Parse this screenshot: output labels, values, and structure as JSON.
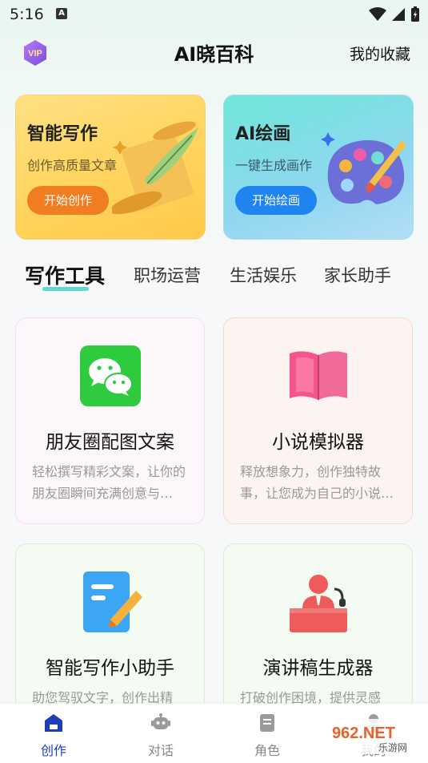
{
  "status": {
    "time": "5:16"
  },
  "header": {
    "title": "AI晓百科",
    "favorites": "我的收藏",
    "vip_label": "VIP"
  },
  "hero": [
    {
      "title": "智能写作",
      "subtitle": "创作高质量文章",
      "button": "开始创作"
    },
    {
      "title": "AI绘画",
      "subtitle": "一键生成画作",
      "button": "开始绘画"
    }
  ],
  "tabs": [
    "写作工具",
    "职场运营",
    "生活娱乐",
    "家长助手"
  ],
  "cards": [
    {
      "title": "朋友圈配图文案",
      "desc": "轻松撰写精彩文案，让你的朋友圈瞬间充满创意与…",
      "icon": "wechat-icon"
    },
    {
      "title": "小说模拟器",
      "desc": "释放想象力，创作独特故事，让您成为自己的小说…",
      "icon": "book-icon"
    },
    {
      "title": "智能写作小助手",
      "desc": "助您驾驭文字，创作出精",
      "icon": "document-pen-icon"
    },
    {
      "title": "演讲稿生成器",
      "desc": "打破创作困境，提供灵感",
      "icon": "speaker-podium-icon"
    }
  ],
  "nav": [
    "创作",
    "对话",
    "角色",
    "我的"
  ],
  "watermark": {
    "brand": "962.NET",
    "sub": "乐游网"
  },
  "colors": {
    "accent_orange": "#f07d1f",
    "accent_blue": "#1f83f0",
    "nav_active": "#1d3fb8"
  }
}
